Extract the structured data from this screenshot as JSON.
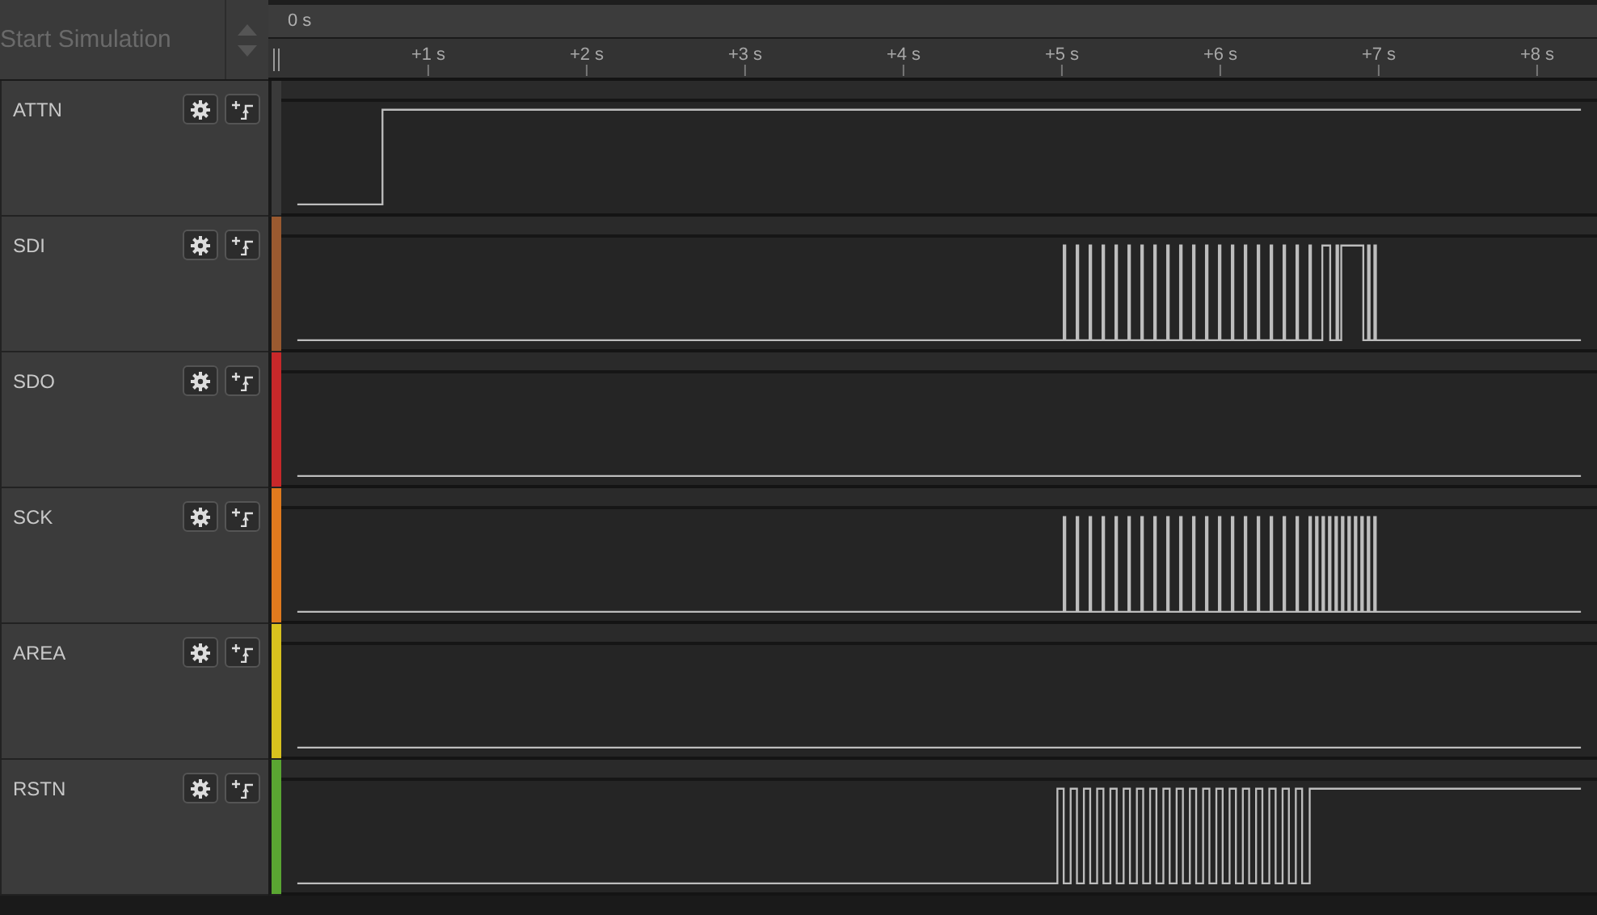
{
  "toolbar": {
    "simulation_button": "Start Simulation",
    "time_origin": "0 s"
  },
  "ruler": {
    "ticks": [
      "+1 s",
      "+2 s",
      "+3 s",
      "+4 s",
      "+5 s",
      "+6 s",
      "+7 s",
      "+8 s"
    ]
  },
  "channels": [
    {
      "name": "ATTN",
      "color": "#3a3a3a"
    },
    {
      "name": "SDI",
      "color": "#9a5a30"
    },
    {
      "name": "SDO",
      "color": "#c8282a"
    },
    {
      "name": "SCK",
      "color": "#e07a1e"
    },
    {
      "name": "AREA",
      "color": "#d8c21e"
    },
    {
      "name": "RSTN",
      "color": "#5aa632"
    }
  ]
}
